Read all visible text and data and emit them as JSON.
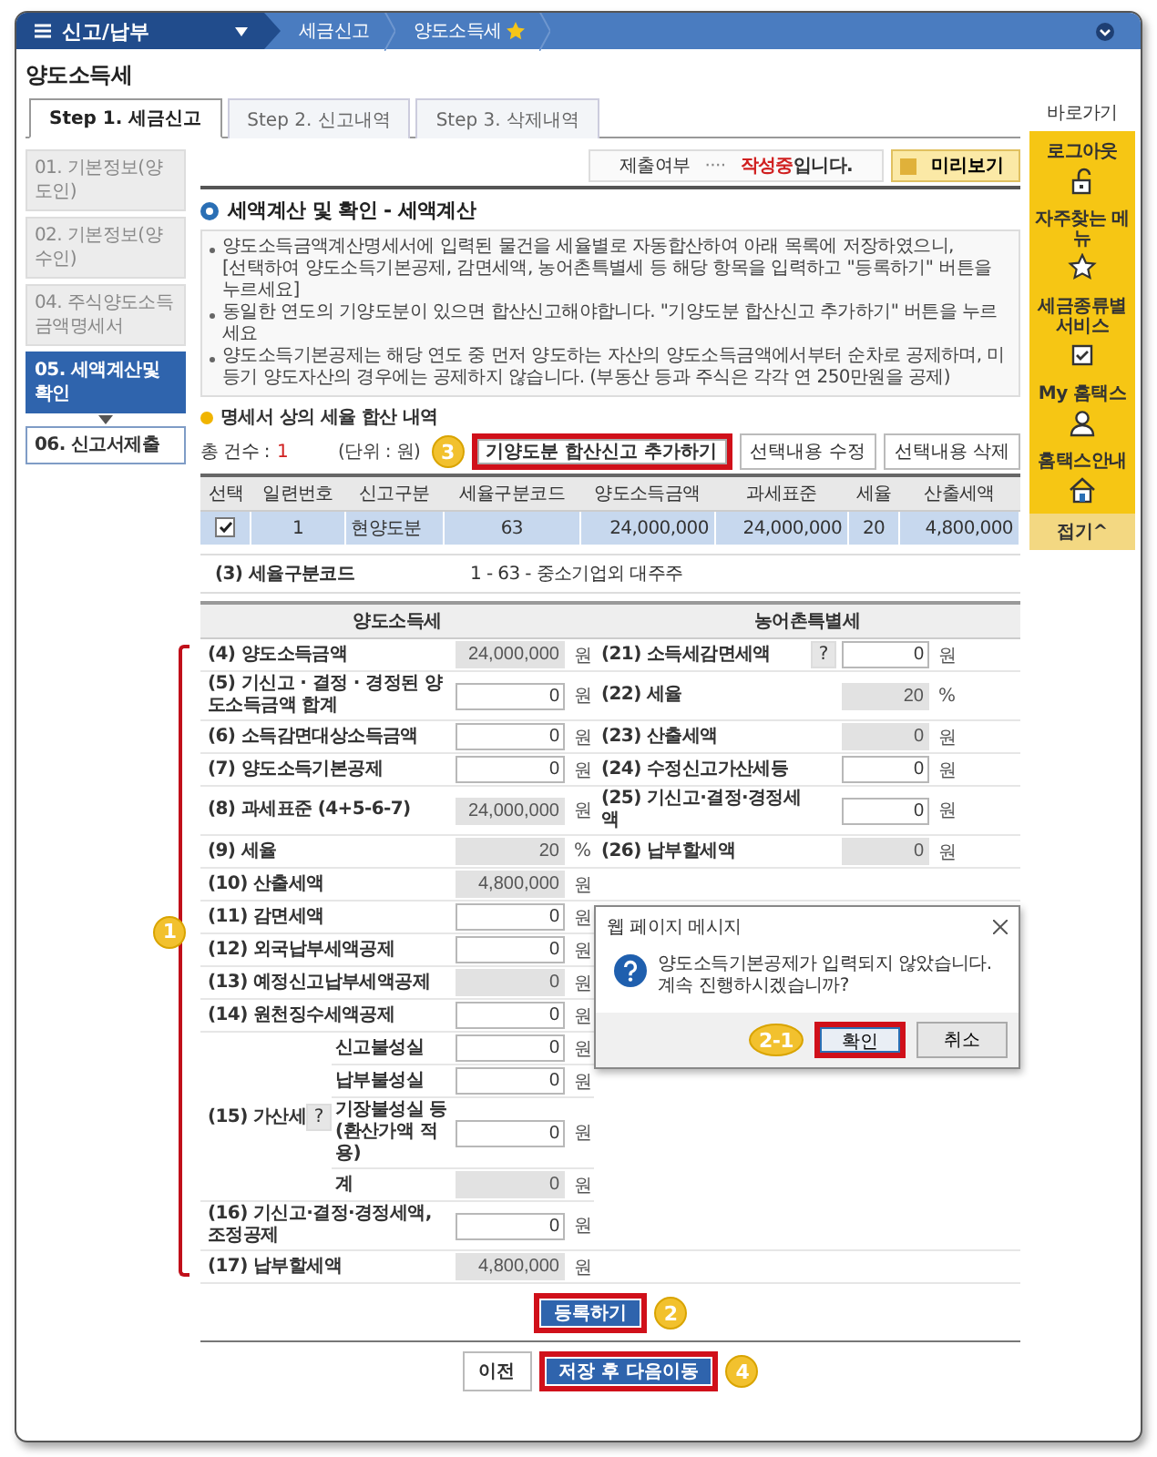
{
  "nav": {
    "menu": "신고/납부",
    "crumbs": [
      {
        "label": "세금신고",
        "starred": false
      },
      {
        "label": "양도소득세",
        "starred": true
      }
    ]
  },
  "page_title": "양도소득세",
  "tabs": [
    {
      "label": "Step 1. 세금신고",
      "selected": true
    },
    {
      "label": "Step 2. 신고내역",
      "selected": false
    },
    {
      "label": "Step 3. 삭제내역",
      "selected": false
    }
  ],
  "steps": [
    {
      "label": "01. 기본정보(양도인)",
      "selected": false,
      "completed": true
    },
    {
      "label": "02. 기본정보(양수인)",
      "selected": false,
      "completed": true
    },
    {
      "label": "04. 주식양도소득금액명세서",
      "selected": false,
      "completed": true
    },
    {
      "label": "05. 세액계산및확인",
      "selected": true,
      "completed": false
    },
    {
      "label": "06. 신고서제출",
      "selected": false,
      "completed": false
    }
  ],
  "status": {
    "label": "제출여부",
    "dots": "····",
    "value": "작성중",
    "suffix": "입니다.",
    "preview_button": "미리보기"
  },
  "section_title": "세액계산 및 확인 - 세액계산",
  "notes": [
    "양도소득금액계산명세서에 입력된 물건을 세율별로 자동합산하여 아래 목록에 저장하였으니,\n[선택하여 양도소득기본공제, 감면세액, 농어촌특별세 등 해당 항목을 입력하고 \"등록하기\" 버튼을 누르세요]",
    "동일한 연도의 기양도분이 있으면 합산신고해야합니다. \"기양도분 합산신고 추가하기\" 버튼을 누르세요",
    "양도소득기본공제는 해당 연도 중 먼저 양도하는 자산의 양도소득금액에서부터 순차로 공제하며, 미등기 양도자산의 경우에는 공제하지 않습니다. (부동산 등과 주식은 각각 연 250만원을 공제)"
  ],
  "summary": {
    "title": "명세서 상의 세율 합산 내역",
    "count_label": "총 건수 :",
    "count": "1",
    "unit": "(단위 : 원)",
    "buttons": [
      {
        "label": "기양도분 합산신고 추가하기",
        "highlighted": true,
        "badge": "3"
      },
      {
        "label": "선택내용 수정",
        "highlighted": false
      },
      {
        "label": "선택내용 삭제",
        "highlighted": false
      }
    ],
    "columns": [
      "선택",
      "일련번호",
      "신고구분",
      "세율구분코드",
      "양도소득금액",
      "과세표준",
      "세율",
      "산출세액"
    ],
    "rows": [
      {
        "checked": true,
        "selected": true,
        "cells": [
          "",
          "1",
          "현양도분",
          "63",
          "24,000,000",
          "24,000,000",
          "20",
          "4,800,000"
        ]
      }
    ]
  },
  "rate_code": {
    "label": "(3) 세율구분코드",
    "value": "1 - 63 - 중소기업외 대주주"
  },
  "tax_form": {
    "left_title": "양도소득세",
    "right_title": "농어촌특별세",
    "badge": "1",
    "left_rows": [
      {
        "kind": "field",
        "label": "(4) 양도소득금액",
        "value": "24,000,000",
        "unit": "원",
        "readonly": true
      },
      {
        "kind": "field",
        "label": "(5) 기신고 · 결정 · 경정된 양도소득금액 합계",
        "value": "0",
        "unit": "원",
        "readonly": false
      },
      {
        "kind": "field",
        "label": "(6) 소득감면대상소득금액",
        "value": "0",
        "unit": "원",
        "readonly": false
      },
      {
        "kind": "field",
        "label": "(7) 양도소득기본공제",
        "value": "0",
        "unit": "원",
        "readonly": false
      },
      {
        "kind": "field",
        "label": "(8) 과세표준 (4+5-6-7)",
        "value": "24,000,000",
        "unit": "원",
        "readonly": true
      },
      {
        "kind": "field",
        "label": "(9) 세율",
        "value": "20",
        "unit": "%",
        "readonly": true
      },
      {
        "kind": "field",
        "label": "(10) 산출세액",
        "value": "4,800,000",
        "unit": "원",
        "readonly": true
      },
      {
        "kind": "field",
        "label": "(11) 감면세액",
        "value": "0",
        "unit": "원",
        "readonly": false
      },
      {
        "kind": "field",
        "label": "(12) 외국납부세액공제",
        "value": "0",
        "unit": "원",
        "readonly": false
      },
      {
        "kind": "field",
        "label": "(13) 예정신고납부세액공제",
        "value": "0",
        "unit": "원",
        "readonly": true
      },
      {
        "kind": "field",
        "label": "(14) 원천징수세액공제",
        "value": "0",
        "unit": "원",
        "readonly": false
      },
      {
        "kind": "group",
        "label": "(15) 가산세",
        "help": "?",
        "items": [
          {
            "label": "신고불성실",
            "value": "0",
            "unit": "원",
            "readonly": false
          },
          {
            "label": "납부불성실",
            "value": "0",
            "unit": "원",
            "readonly": false
          },
          {
            "label": "기장불성실 등 (환산가액 적용)",
            "value": "0",
            "unit": "원",
            "readonly": false
          },
          {
            "label": "계",
            "value": "0",
            "unit": "원",
            "readonly": true
          }
        ]
      },
      {
        "kind": "field",
        "label": "(16) 기신고·결정·경정세액, 조정공제",
        "value": "0",
        "unit": "원",
        "readonly": false
      },
      {
        "kind": "field",
        "label": "(17) 납부할세액",
        "value": "4,800,000",
        "unit": "원",
        "readonly": true
      }
    ],
    "right_rows": [
      {
        "label": "(21) 소득세감면세액",
        "help": "?",
        "value": "0",
        "unit": "원",
        "readonly": false
      },
      {
        "label": "(22) 세율",
        "value": "20",
        "unit": "%",
        "readonly": true
      },
      {
        "label": "(23) 산출세액",
        "value": "0",
        "unit": "원",
        "readonly": true
      },
      {
        "label": "(24) 수정신고가산세등",
        "value": "0",
        "unit": "원",
        "readonly": false
      },
      {
        "label": "(25) 기신고·결정·경정세액",
        "value": "0",
        "unit": "원",
        "readonly": false
      },
      {
        "label": "(26) 납부할세액",
        "value": "0",
        "unit": "원",
        "readonly": true
      }
    ]
  },
  "dialog": {
    "title": "웹 페이지 메시지",
    "message": "양도소득기본공제가 입력되지 않았습니다. 계속 진행하시겠습니까?",
    "buttons": [
      {
        "label": "확인",
        "highlighted": true,
        "badge": "2-1"
      },
      {
        "label": "취소",
        "highlighted": false
      }
    ]
  },
  "register_button": {
    "label": "등록하기",
    "highlighted": true,
    "badge": "2"
  },
  "footer_buttons": [
    {
      "label": "이전",
      "kind": "secondary",
      "highlighted": false
    },
    {
      "label": "저장 후 다음이동",
      "kind": "primary",
      "highlighted": true,
      "badge": "4"
    }
  ],
  "quick_links": {
    "title": "바로가기",
    "items": [
      {
        "label": "로그아웃",
        "kind": "lock"
      },
      {
        "label": "자주찾는 메뉴",
        "kind": "star"
      },
      {
        "label": "세금종류별 서비스",
        "kind": "check"
      },
      {
        "label": "My 홈택스",
        "kind": "person"
      },
      {
        "label": "홈택스안내",
        "kind": "house"
      }
    ],
    "collapse": "접기^"
  }
}
